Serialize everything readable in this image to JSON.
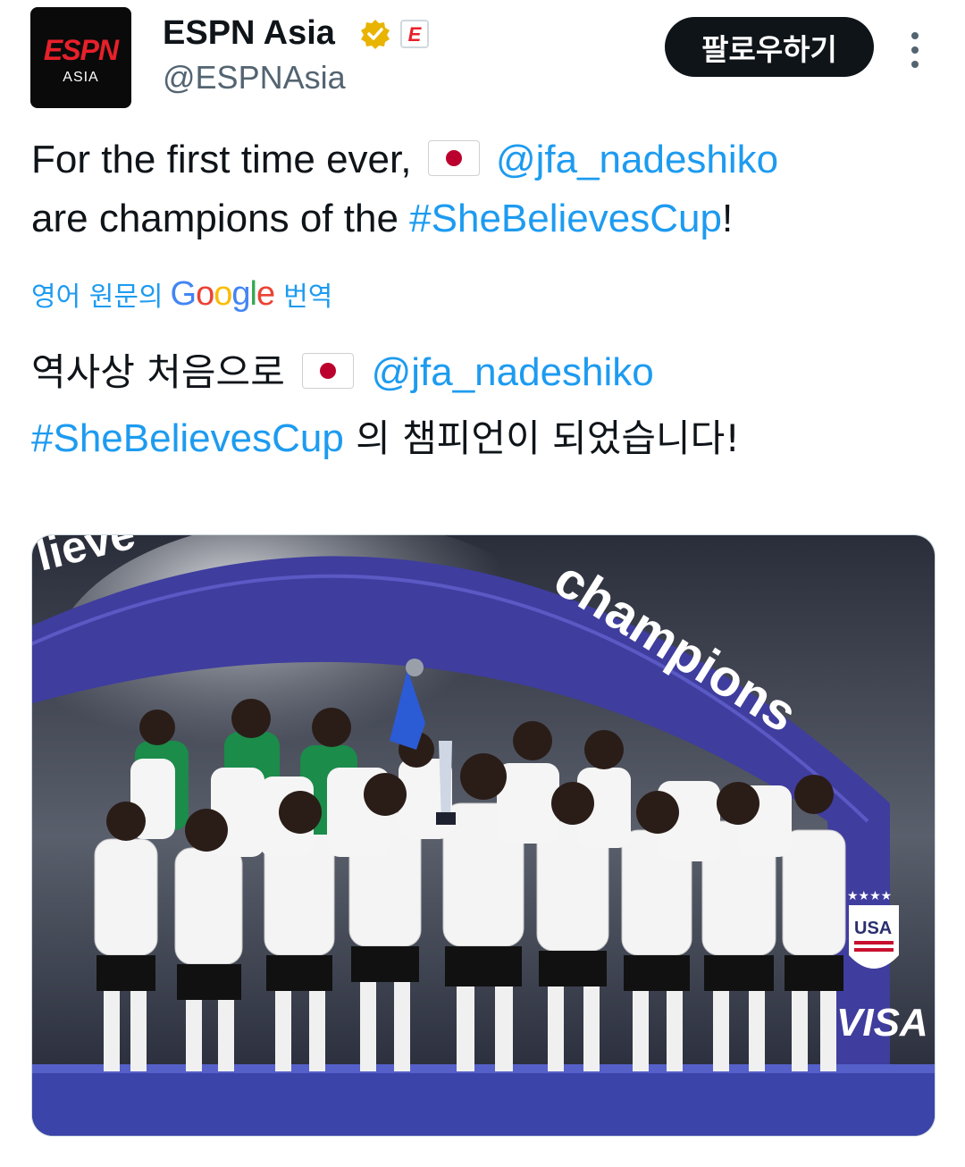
{
  "account": {
    "name": "ESPN Asia",
    "handle": "@ESPNAsia",
    "avatar_logo": "ESPN",
    "avatar_sub": "ASIA",
    "affiliate_badge": "E"
  },
  "follow_button": {
    "label": "팔로우하기"
  },
  "more_icon": "vertical-dots-icon",
  "tweet": {
    "line1_text": "For the first time ever,",
    "mention": "@jfa_nadeshiko",
    "line2_text": "are champions of the",
    "hashtag": "#SheBelievesCup",
    "line2_end": "!"
  },
  "translate": {
    "prefix": "영어 원문의",
    "google": "Google",
    "suffix": "번역"
  },
  "translated": {
    "line1_text": "역사상 처음으로",
    "mention": "@jfa_nadeshiko",
    "hashtag": "#SheBelievesCup",
    "line2_text": "의 챔피언이 되었습니다!"
  },
  "media": {
    "arch_text": "champions",
    "arch_left_text": "lieve",
    "badge_text": "USA",
    "sponsor_text": "VISA"
  },
  "colors": {
    "link": "#1d9bf0",
    "text": "#0f1419",
    "secondary": "#536471",
    "espn_red": "#e8202a",
    "verified_gold": "#e8b400",
    "arch_blue": "#3f3d9e"
  }
}
